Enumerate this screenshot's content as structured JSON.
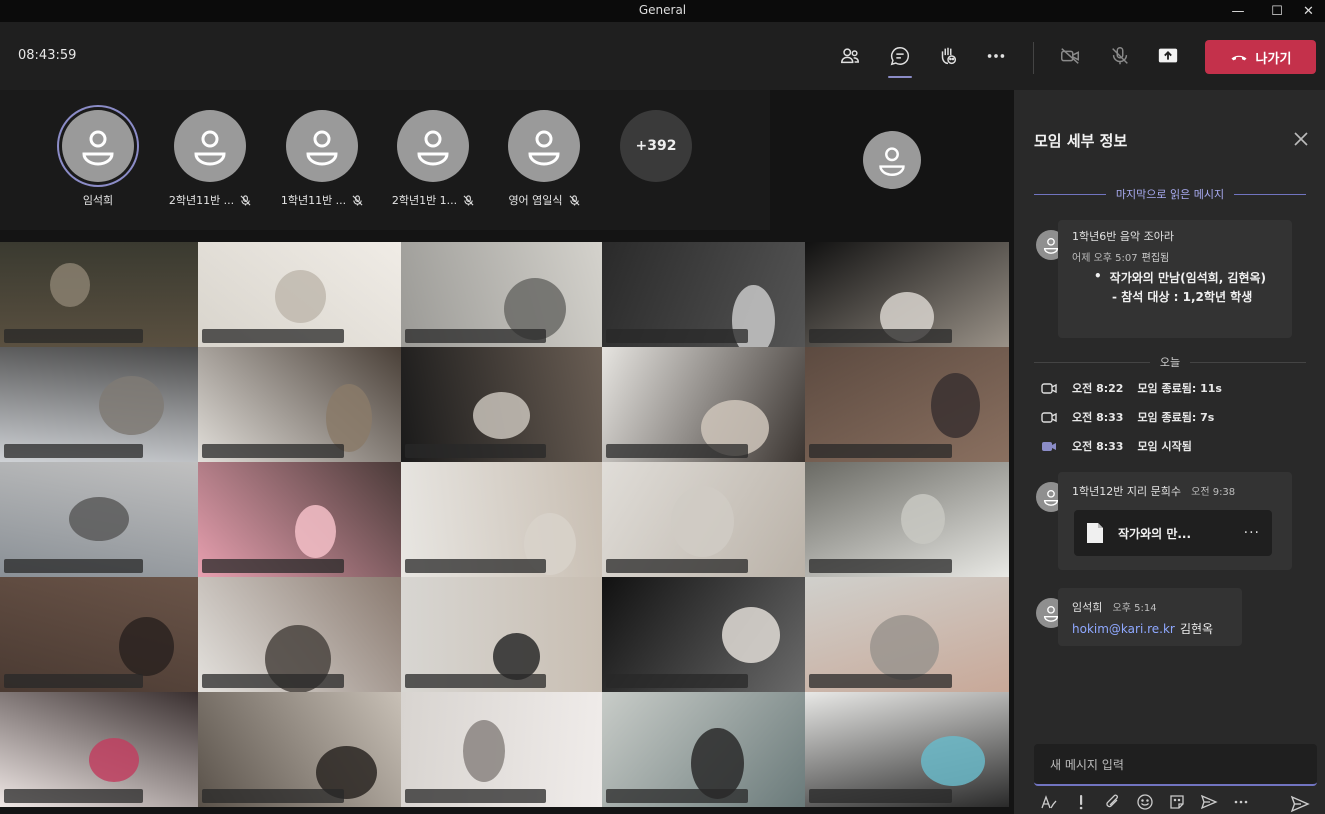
{
  "window": {
    "title": "General"
  },
  "toolbar": {
    "clock": "08:43:59",
    "leave_label": "나가기"
  },
  "participants": [
    {
      "name": "임석희",
      "muted": false,
      "speaking": true
    },
    {
      "name": "2학년11반 ...",
      "muted": true
    },
    {
      "name": "1학년11반 ...",
      "muted": true
    },
    {
      "name": "2학년1반 1...",
      "muted": true
    },
    {
      "name": "영어 염일식",
      "muted": true
    }
  ],
  "overflow_count": "+392",
  "panel": {
    "title": "모임 세부 정보",
    "last_read": "마지막으로 읽은 메시지",
    "msg1": {
      "sender": "1학년6반 음악 조아라",
      "time": "어제 오후 5:07",
      "edited": "편집됨",
      "bullet": "작가와의 만남(임석희, 김현옥)",
      "sub": "- 참석 대상 : 1,2학년 학생"
    },
    "today": "오늘",
    "events": [
      {
        "time": "오전 8:22",
        "text": "모임 종료됨: 11s"
      },
      {
        "time": "오전 8:33",
        "text": "모임 종료됨: 7s"
      },
      {
        "time": "오전 8:33",
        "text": "모임 시작됨"
      }
    ],
    "msg2": {
      "sender": "1학년12반 지리 문희수",
      "time": "오전 9:38",
      "file": "작가와의 만..."
    },
    "msg3": {
      "sender": "임석희",
      "time": "오후 5:14",
      "link": "hokim@kari.re.kr",
      "text": "김현옥"
    },
    "compose_placeholder": "새 메시지 입력"
  }
}
